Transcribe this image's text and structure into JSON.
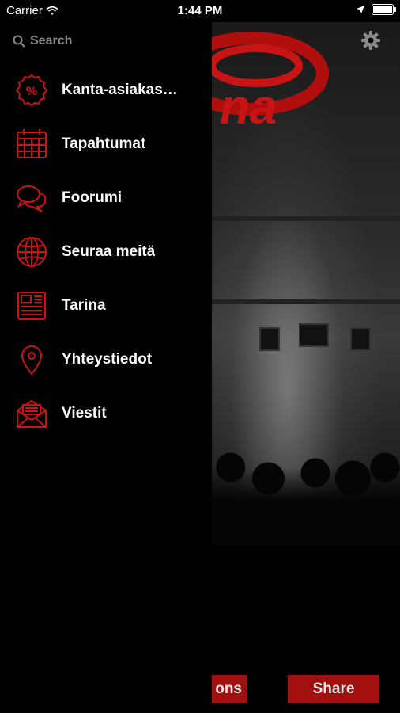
{
  "status_bar": {
    "carrier": "Carrier",
    "time": "1:44 PM"
  },
  "menu": {
    "search_placeholder": "Search",
    "items": [
      {
        "label": "Kanta-asiakas…",
        "icon": "percent-badge-icon"
      },
      {
        "label": "Tapahtumat",
        "icon": "calendar-icon"
      },
      {
        "label": "Foorumi",
        "icon": "chat-bubbles-icon"
      },
      {
        "label": "Seuraa meitä",
        "icon": "globe-icon"
      },
      {
        "label": "Tarina",
        "icon": "newspaper-icon"
      },
      {
        "label": "Yhteystiedot",
        "icon": "location-pin-icon"
      },
      {
        "label": "Viestit",
        "icon": "envelope-icon"
      }
    ]
  },
  "bottom_bar": {
    "left_button_label": "ons",
    "share_label": "Share"
  },
  "colors": {
    "accent": "#c81414",
    "button": "#a10f0f",
    "background": "#000000"
  }
}
